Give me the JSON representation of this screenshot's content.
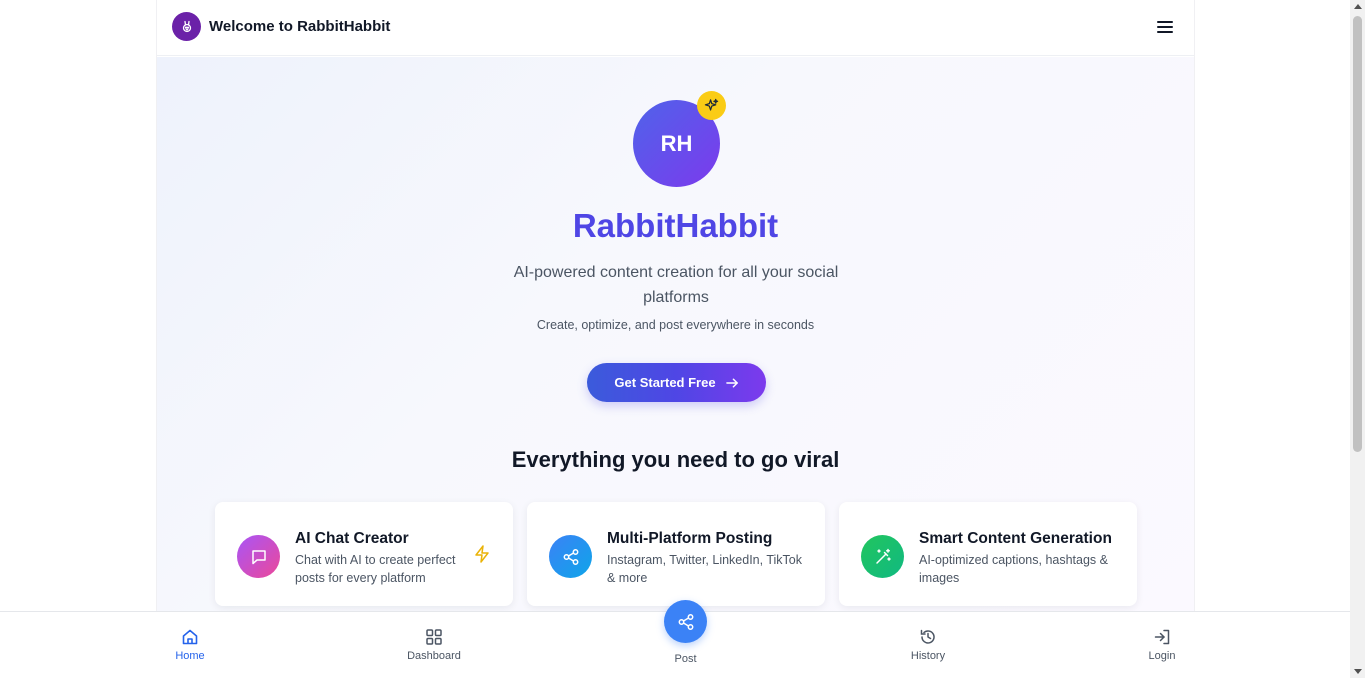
{
  "header": {
    "title": "Welcome to RabbitHabbit",
    "logo_icon": "rabbit-icon",
    "menu_icon": "hamburger-menu-icon"
  },
  "hero": {
    "avatar_initials": "RH",
    "badge_icon": "sparkles-icon",
    "brand": "RabbitHabbit",
    "tagline": "AI-powered content creation for all your social platforms",
    "subline": "Create, optimize, and post everywhere in seconds",
    "cta_label": "Get Started Free",
    "cta_icon": "arrow-right-icon"
  },
  "features": {
    "title": "Everything you need to go viral",
    "items": [
      {
        "title": "AI Chat Creator",
        "description": "Chat with AI to create perfect posts for every platform",
        "icon": "chat-bubble-icon",
        "accent": "bolt-icon"
      },
      {
        "title": "Multi-Platform Posting",
        "description": "Instagram, Twitter, LinkedIn, TikTok & more",
        "icon": "share-icon"
      },
      {
        "title": "Smart Content Generation",
        "description": "AI-optimized captions, hashtags & images",
        "icon": "magic-wand-icon"
      }
    ]
  },
  "bottom_nav": {
    "home": "Home",
    "dashboard": "Dashboard",
    "post": "Post",
    "history": "History",
    "login": "Login"
  },
  "colors": {
    "brand": "#4f46e5",
    "active_nav": "#2563eb",
    "post_fab": "#3b82f6",
    "sparkle_badge": "#facc15",
    "chat_icon_bg": "#c026d3",
    "share_icon_bg": "#2563eb",
    "wand_icon_bg": "#16a34a"
  }
}
